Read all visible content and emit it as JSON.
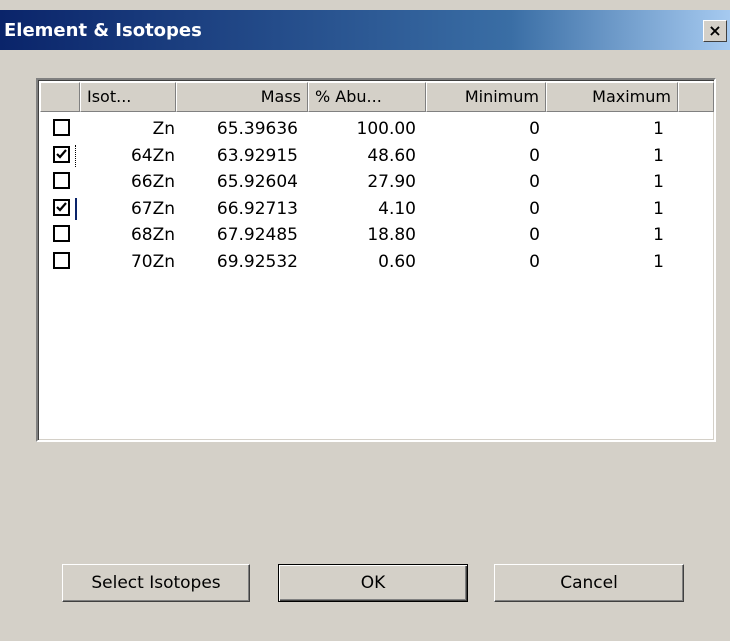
{
  "window": {
    "title": "Element & Isotopes",
    "close_glyph": "×"
  },
  "table": {
    "columns": [
      "Isot...",
      "Mass",
      "% Abu...",
      "Minimum",
      "Maximum"
    ],
    "rows": [
      {
        "checked": false,
        "isotope": "Zn",
        "mass": "65.39636",
        "abundance": "100.00",
        "minimum": "0",
        "maximum": "1"
      },
      {
        "checked": true,
        "isotope": "64Zn",
        "mass": "63.92915",
        "abundance": "48.60",
        "minimum": "0",
        "maximum": "1"
      },
      {
        "checked": false,
        "isotope": "66Zn",
        "mass": "65.92604",
        "abundance": "27.90",
        "minimum": "0",
        "maximum": "1"
      },
      {
        "checked": true,
        "isotope": "67Zn",
        "mass": "66.92713",
        "abundance": "4.10",
        "minimum": "0",
        "maximum": "1"
      },
      {
        "checked": false,
        "isotope": "68Zn",
        "mass": "67.92485",
        "abundance": "18.80",
        "minimum": "0",
        "maximum": "1"
      },
      {
        "checked": false,
        "isotope": "70Zn",
        "mass": "69.92532",
        "abundance": "0.60",
        "minimum": "0",
        "maximum": "1"
      }
    ]
  },
  "buttons": {
    "select_isotopes": "Select Isotopes",
    "ok": "OK",
    "cancel": "Cancel"
  }
}
